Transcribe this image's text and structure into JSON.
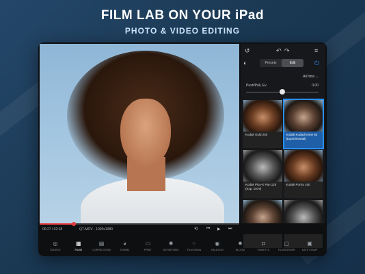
{
  "headline": "FILM LAB ON YOUR iPad",
  "subheadline": "PHOTO & VIDEO EDITING",
  "panel": {
    "segments": [
      "Presets",
      "Edit"
    ],
    "active_segment": "Edit",
    "filter_dropdown": "All films ⌄",
    "push_label": "Push/Pull, Ev",
    "push_value": "0.00",
    "push_level": 0.5
  },
  "thumbnails": [
    {
      "label": "Kodak Gold 200",
      "selected": false
    },
    {
      "label": "Kodak Kodachrome 64 (Experimental)",
      "selected": true
    },
    {
      "label": "Kodak Plus-X Pan 125 (Exp. 1979)",
      "selected": false
    },
    {
      "label": "Kodak Portra 160",
      "selected": false
    },
    {
      "label": "",
      "selected": false
    },
    {
      "label": "",
      "selected": false
    }
  ],
  "timeline": {
    "time": "00:27 / 02:18",
    "format": "QT-MOV · 1920x1080",
    "progress": 0.17
  },
  "toolbar": [
    {
      "label": "SOURCE",
      "icon": "aperture-icon",
      "active": false
    },
    {
      "label": "FILMS",
      "icon": "films-icon",
      "active": true
    },
    {
      "label": "CORRECTIONS",
      "icon": "corrections-icon",
      "active": false
    },
    {
      "label": "TONING",
      "icon": "toning-icon",
      "active": false
    },
    {
      "label": "PRINT",
      "icon": "print-icon",
      "active": false
    },
    {
      "label": "DEFINITIONS",
      "icon": "definitions-icon",
      "active": false
    },
    {
      "label": "FILM GRAIN",
      "icon": "grain-icon",
      "active": false
    },
    {
      "label": "HALATION",
      "icon": "halation-icon",
      "active": false
    },
    {
      "label": "BLOOM",
      "icon": "bloom-icon",
      "active": false
    },
    {
      "label": "VIGNETTE",
      "icon": "vignette-icon",
      "active": false
    },
    {
      "label": "FILM BORDER",
      "icon": "border-icon",
      "active": false
    },
    {
      "label": "DATE STAMP",
      "icon": "date-stamp-icon",
      "active": false
    }
  ]
}
